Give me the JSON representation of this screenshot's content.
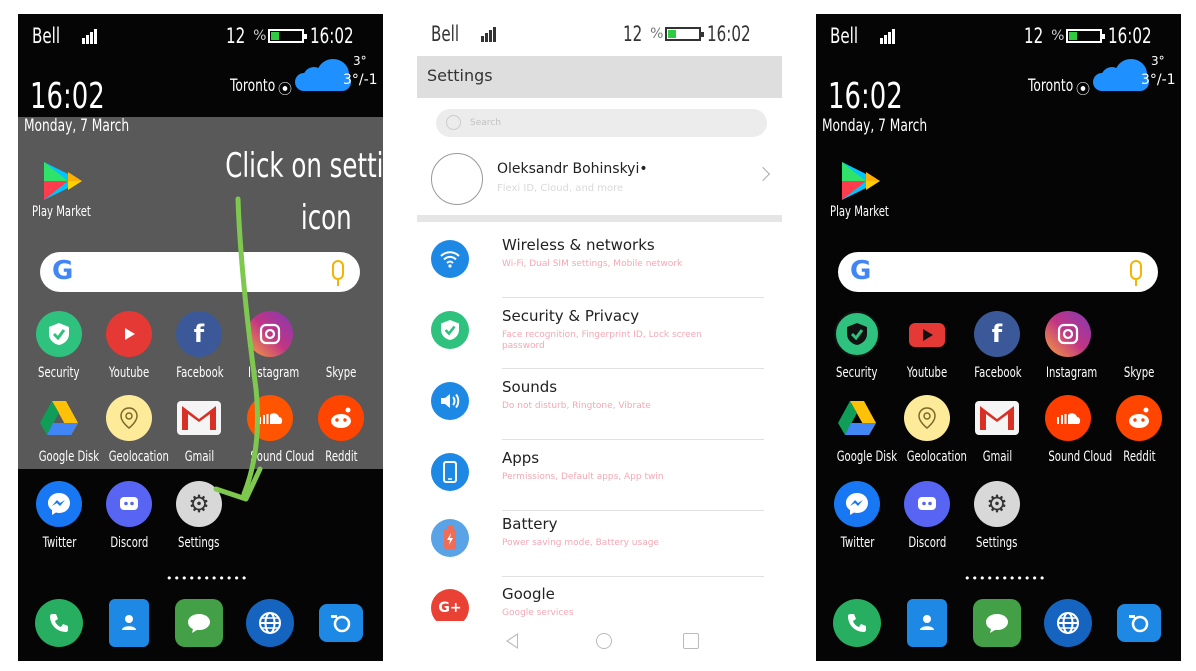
{
  "home": {
    "carrier": "Bell",
    "battery_pct": "12",
    "battery_pct_symbol": "%",
    "battery_level": 0.12,
    "time": "16:02",
    "clock": "16:02",
    "city": "Toronto",
    "temp_current": "3°",
    "temp_range": "3°/-1",
    "date": "Monday, 7 March",
    "play_market": "Play Market",
    "apps_row1": [
      "Security",
      "Youtube",
      "Facebook",
      "Instagram",
      "Skype"
    ],
    "apps_row2": [
      "Google Disk",
      "Geolocation",
      "Gmail",
      "Sound Cloud",
      "Reddit"
    ],
    "apps_row3": [
      "Twitter",
      "Discord",
      "Settings"
    ],
    "page_dots": "•••••••••••",
    "hint_line1": "Click on settings",
    "hint_line2": "icon",
    "colors": {
      "security": "#2ec27e",
      "youtube": "#e53935",
      "facebook": "#3b5998",
      "instagram": "#c13584",
      "soundcloud": "#ff5500",
      "reddit": "#ff4500",
      "messenger": "#1877f2",
      "discord": "#5865f2",
      "arrow": "#7ec850",
      "dock_phone": "#27ae60",
      "dock_contacts": "#1e88e5",
      "dock_messages": "#43a047"
    }
  },
  "settings": {
    "carrier": "Bell",
    "battery_pct": "12",
    "battery_pct_symbol": "%",
    "time": "16:02",
    "title": "Settings",
    "search_placeholder": "Search",
    "profile_name": "Oleksandr Bohinskyi•",
    "profile_sub": "Flexi ID, Cloud, and more",
    "items": [
      {
        "title": "Wireless & networks",
        "sub": "Wi-Fi, Dual SIM settings, Mobile network",
        "icon": "wifi-icon",
        "color": "#1e88e5"
      },
      {
        "title": "Security & Privacy",
        "sub": "Face recognition, Fingerprint ID, Lock screen password",
        "icon": "shield-icon",
        "color": "#2ec27e"
      },
      {
        "title": "Sounds",
        "sub": "Do not disturb, Ringtone, Vibrate",
        "icon": "speaker-icon",
        "color": "#1e88e5"
      },
      {
        "title": "Apps",
        "sub": "Permissions, Default apps, App twin",
        "icon": "phone-app-icon",
        "color": "#1e88e5"
      },
      {
        "title": "Battery",
        "sub": "Power saving mode, Battery usage",
        "icon": "battery-icon",
        "color": "#ef6c57"
      },
      {
        "title": "Google",
        "sub": "Google services",
        "icon": "google-plus-icon",
        "color": "#e94235"
      }
    ]
  }
}
